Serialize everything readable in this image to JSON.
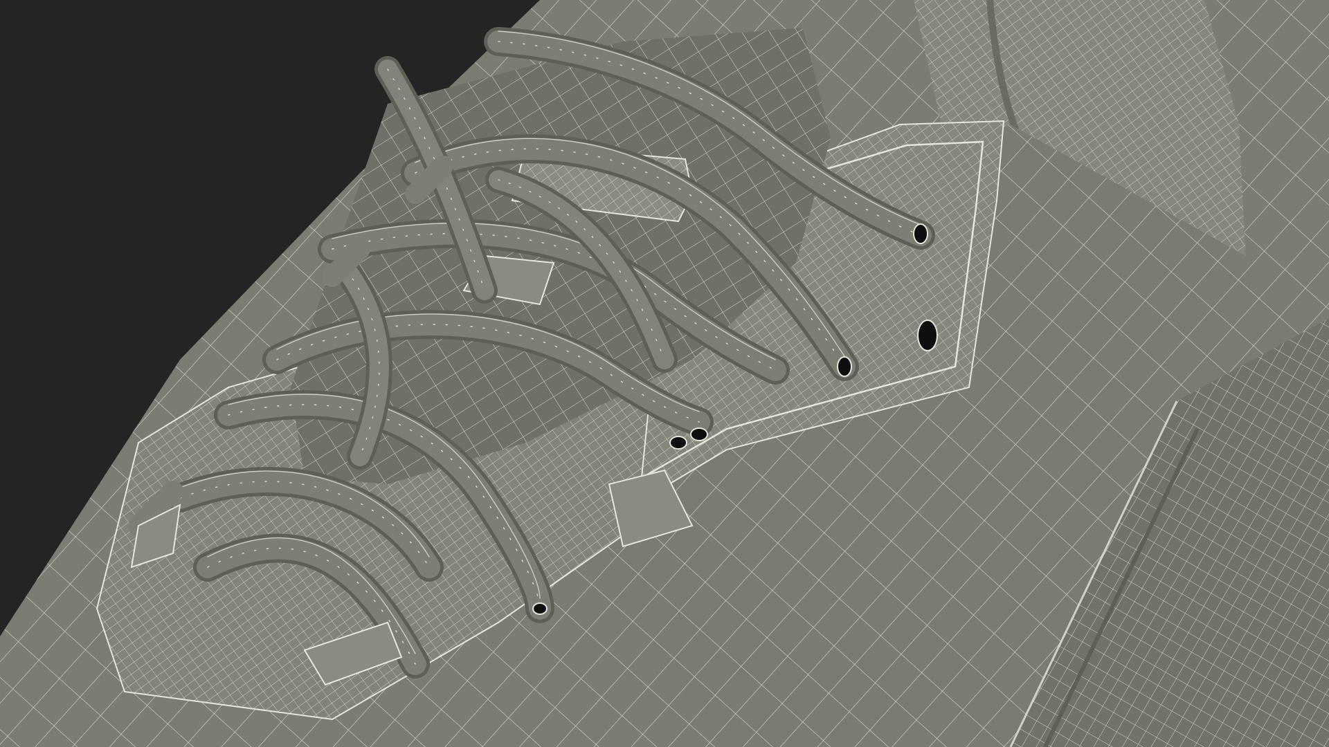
{
  "scene": {
    "subject": "sneaker-wireframe-closeup",
    "colors": {
      "background": "#242424",
      "surface": "#7b7c72",
      "surface_dark": "#5e5f57",
      "surface_light": "#8a8b81",
      "wire": "#e6e7dc",
      "hole": "#0e0e0e"
    }
  }
}
